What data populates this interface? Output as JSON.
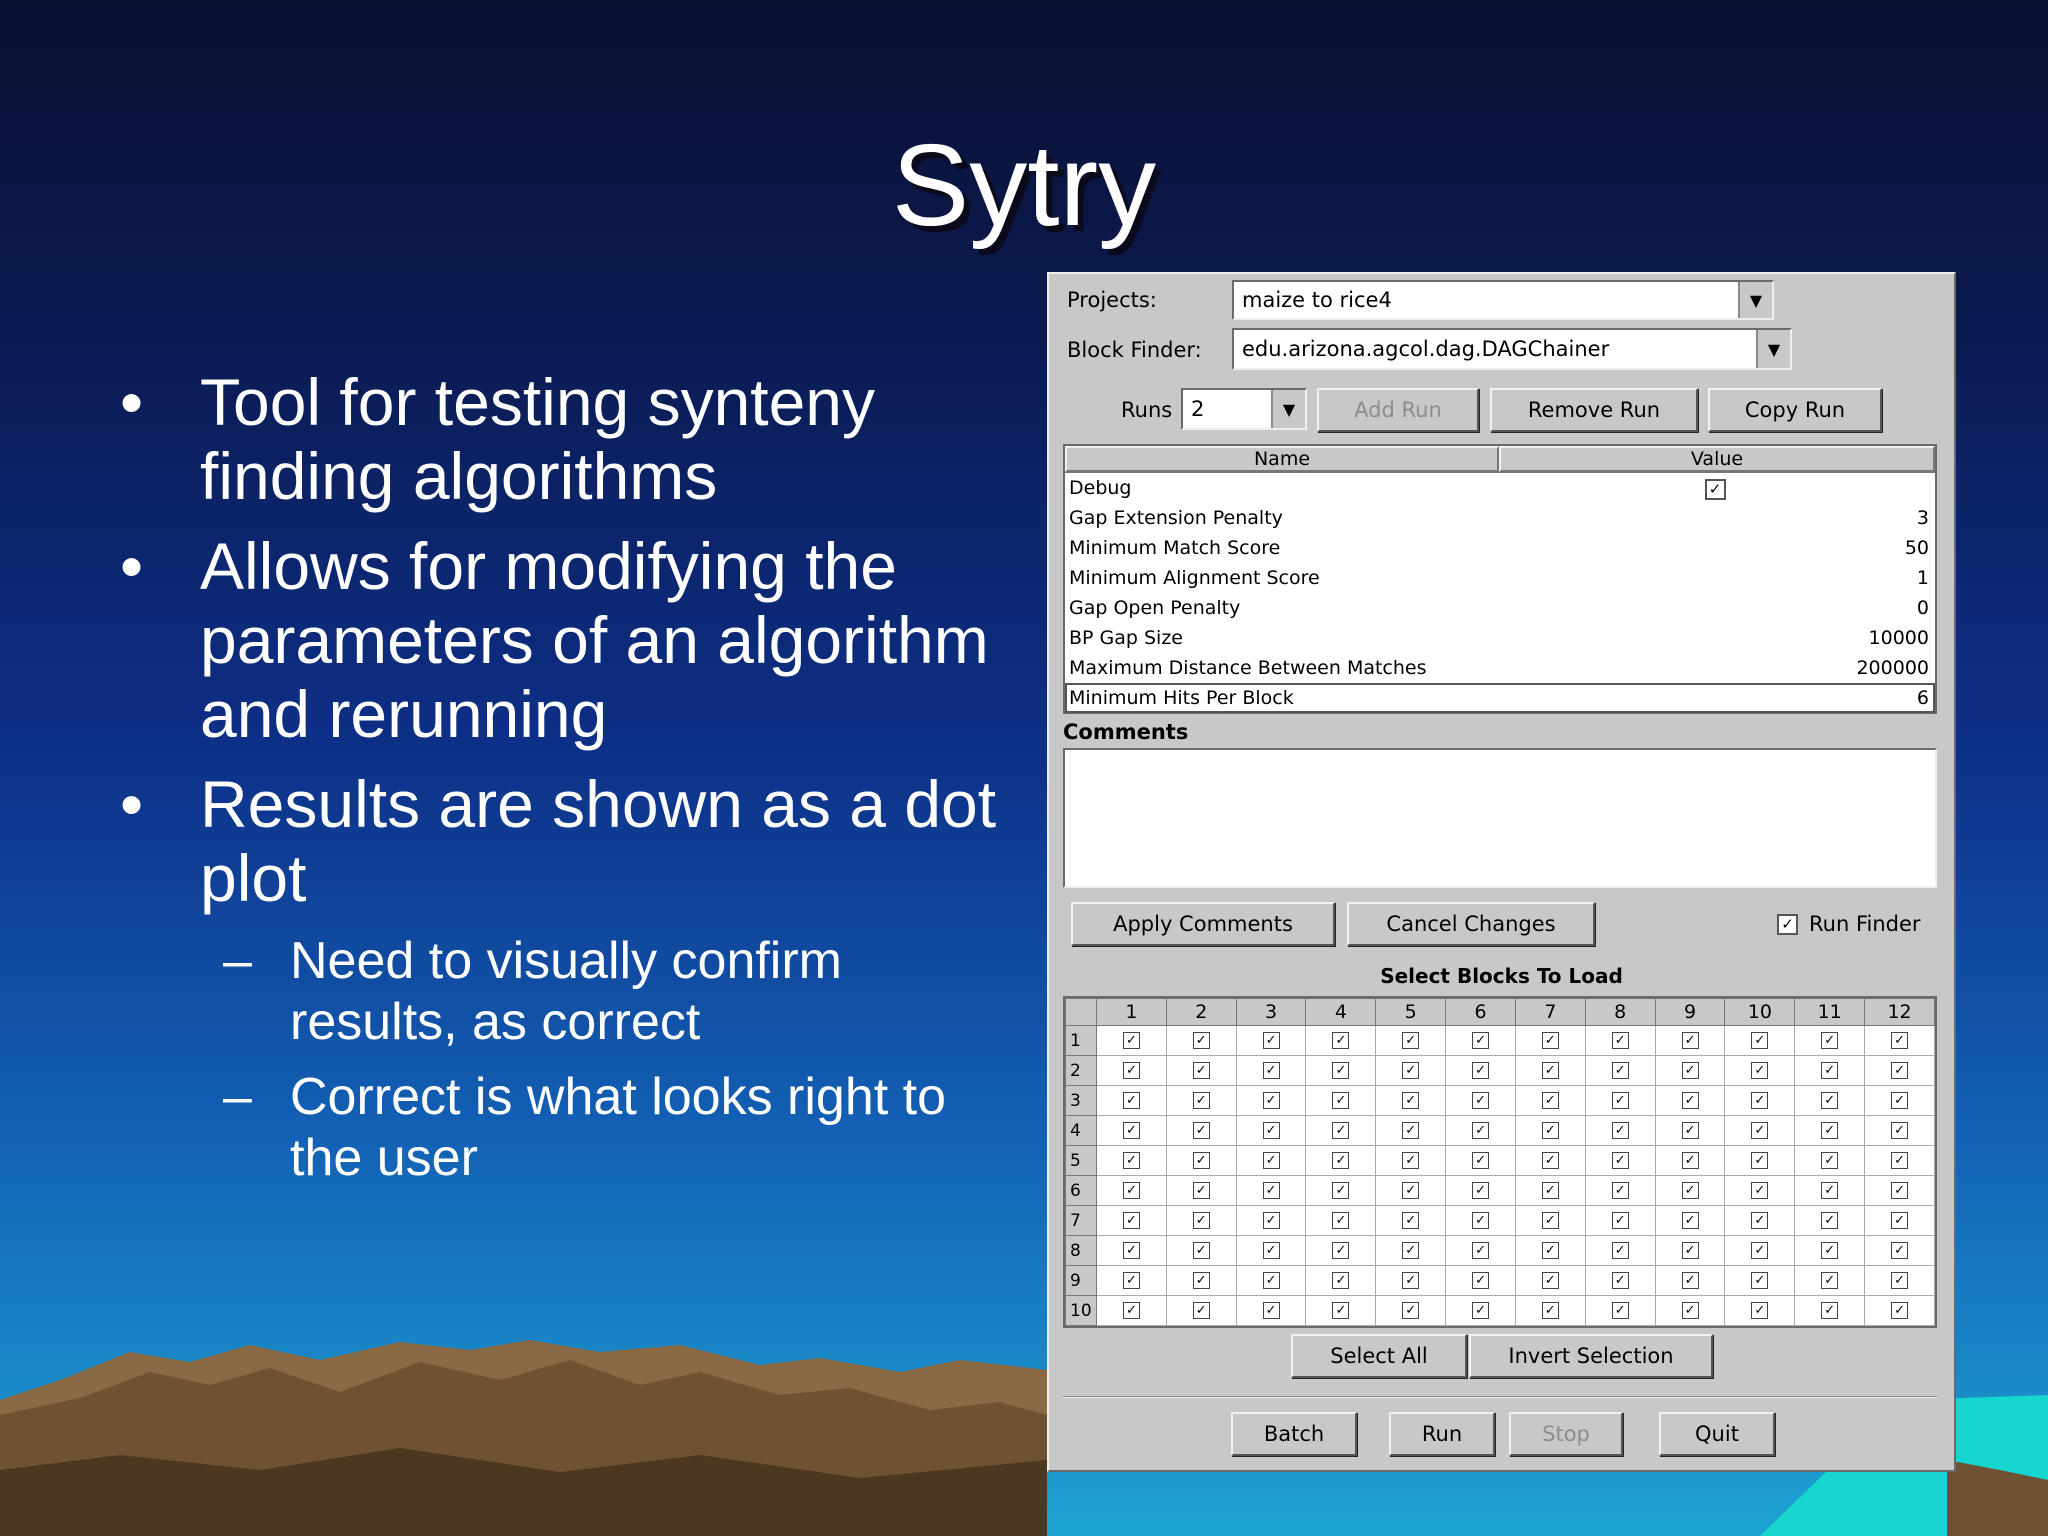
{
  "slide": {
    "title": "Sytry",
    "bullets": [
      {
        "text": "Tool for testing synteny finding algorithms"
      },
      {
        "text": "Allows for modifying the parameters of an algorithm and rerunning"
      },
      {
        "text": "Results are shown as a dot plot"
      }
    ],
    "subbullets": [
      {
        "text": "Need to visually confirm results, as correct"
      },
      {
        "text": "Correct is what looks right to the user"
      }
    ],
    "bullet_symbol": "•",
    "dash_symbol": "–"
  },
  "app": {
    "projects_label": "Projects:",
    "projects_value": "maize to rice4",
    "block_finder_label": "Block Finder:",
    "block_finder_value": "edu.arizona.agcol.dag.DAGChainer",
    "runs_label": "Runs",
    "runs_value": "2",
    "add_run": "Add Run",
    "remove_run": "Remove Run",
    "copy_run": "Copy Run",
    "params_header_name": "Name",
    "params_header_value": "Value",
    "params": [
      {
        "name": "Debug",
        "value": "✓"
      },
      {
        "name": "Gap Extension Penalty",
        "value": "3"
      },
      {
        "name": "Minimum Match Score",
        "value": "50"
      },
      {
        "name": "Minimum Alignment Score",
        "value": "1"
      },
      {
        "name": "Gap Open Penalty",
        "value": "0"
      },
      {
        "name": "BP Gap Size",
        "value": "10000"
      },
      {
        "name": "Maximum Distance Between Matches",
        "value": "200000"
      },
      {
        "name": "Minimum Hits Per Block",
        "value": "6"
      }
    ],
    "comments_label": "Comments",
    "comments_text": "",
    "apply_comments": "Apply Comments",
    "cancel_changes": "Cancel Changes",
    "run_finder_label": "Run Finder",
    "run_finder_checked": "✓",
    "select_blocks_label": "Select Blocks To Load",
    "block_columns": [
      "1",
      "2",
      "3",
      "4",
      "5",
      "6",
      "7",
      "8",
      "9",
      "10",
      "11",
      "12"
    ],
    "block_rows": [
      "1",
      "2",
      "3",
      "4",
      "5",
      "6",
      "7",
      "8",
      "9",
      "10"
    ],
    "block_check_glyph": "✓",
    "select_all": "Select All",
    "invert_selection": "Invert Selection",
    "batch": "Batch",
    "run": "Run",
    "stop": "Stop",
    "quit": "Quit",
    "dropdown_arrow": "▼"
  },
  "colors": {
    "sky_top": "#0a1030",
    "sky_bottom": "#1ea3d2",
    "mountain": "#6e5232",
    "window_bg": "#c8c8c8"
  }
}
